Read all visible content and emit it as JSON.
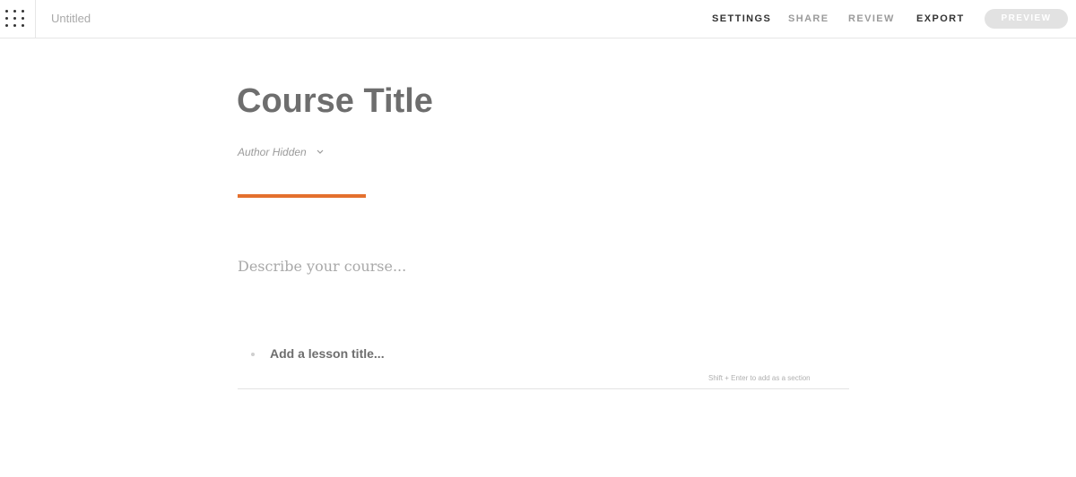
{
  "header": {
    "doc_title": "Untitled",
    "nav": {
      "settings": "SETTINGS",
      "share": "SHARE",
      "review": "REVIEW",
      "export": "EXPORT"
    },
    "preview_label": "PREVIEW",
    "apps_icon": "grid-icon"
  },
  "main": {
    "course_title": "Course Title",
    "author_label": "Author Hidden",
    "author_icon": "chevron-down-icon",
    "accent_color": "#e4702e",
    "description_placeholder": "Describe your course...",
    "lesson_placeholder": "Add a lesson title...",
    "lesson_hint": "Shift + Enter to add as a section"
  }
}
